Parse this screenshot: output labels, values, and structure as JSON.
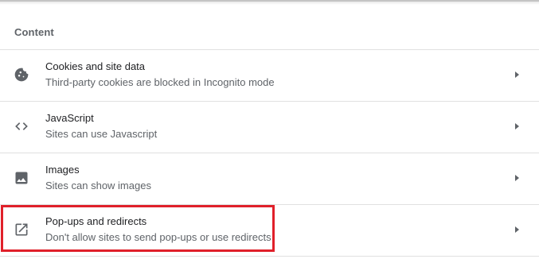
{
  "section": {
    "title": "Content"
  },
  "rows": [
    {
      "title": "Cookies and site data",
      "subtitle": "Third-party cookies are blocked in Incognito mode",
      "icon": "cookie-icon"
    },
    {
      "title": "JavaScript",
      "subtitle": "Sites can use Javascript",
      "icon": "code-icon"
    },
    {
      "title": "Images",
      "subtitle": "Sites can show images",
      "icon": "image-icon"
    },
    {
      "title": "Pop-ups and redirects",
      "subtitle": "Don't allow sites to send pop-ups or use redirects",
      "icon": "open-in-new-icon"
    }
  ],
  "colors": {
    "highlight": "#e0202a",
    "primary_text": "#202124",
    "secondary_text": "#5f6368",
    "divider": "#e0e0e0"
  }
}
